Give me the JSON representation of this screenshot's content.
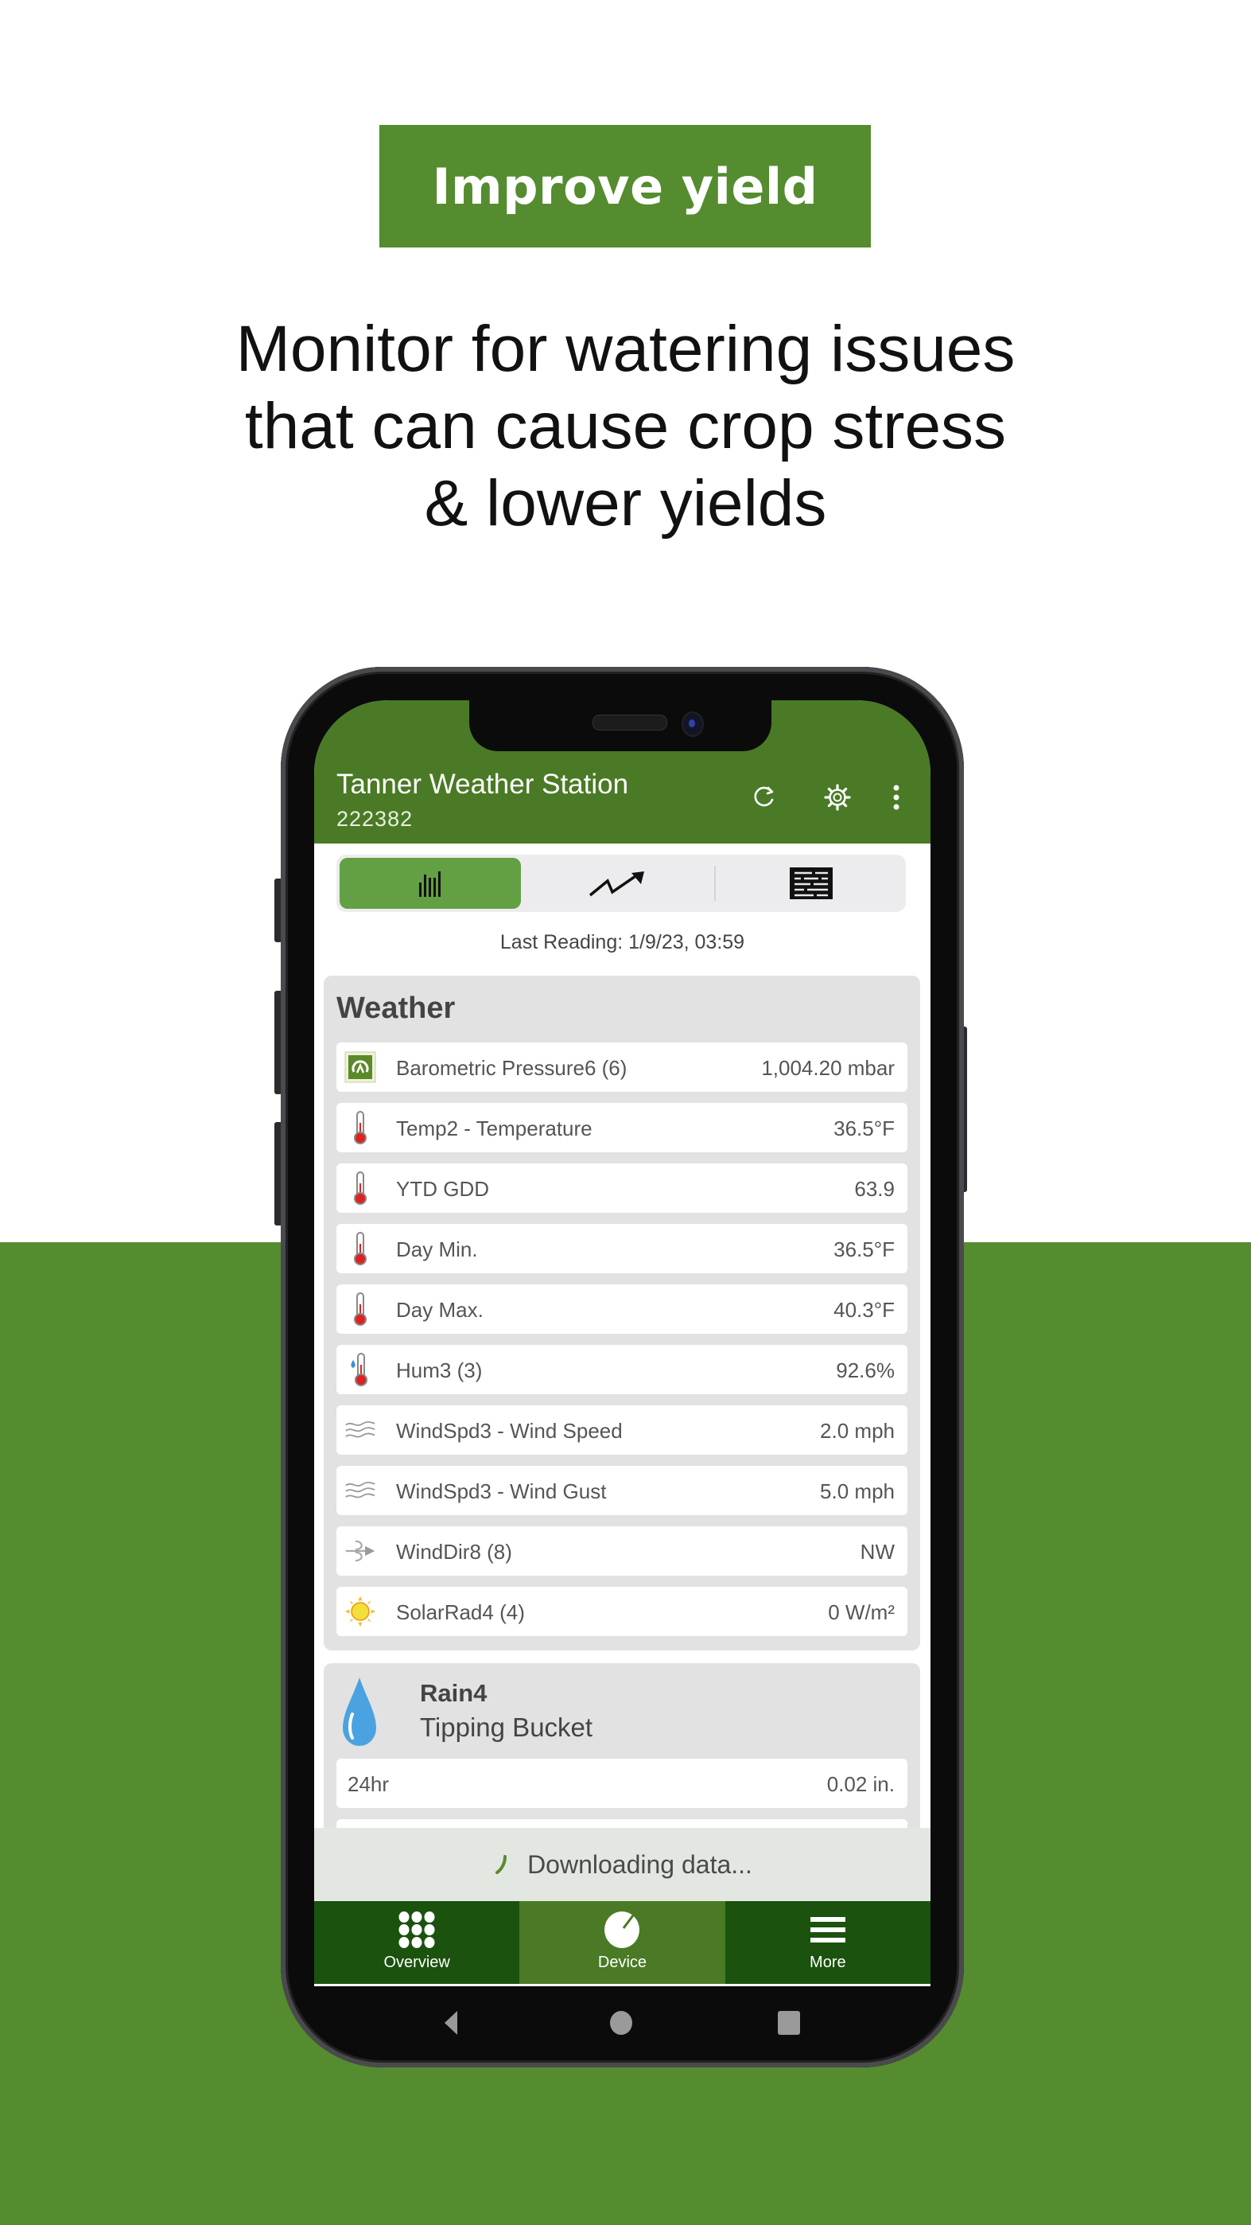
{
  "promo": {
    "badge_label": "Improve yield",
    "subtitle_lines": [
      "Monitor for watering issues",
      "that can cause crop stress",
      "& lower yields"
    ],
    "accent_color": "#548C2F"
  },
  "app": {
    "title": "Tanner Weather Station",
    "device_id": "222382",
    "actions": {
      "refresh_icon": "refresh-icon",
      "settings_icon": "gear-icon",
      "more_icon": "more-vertical-icon"
    },
    "view_tabs": [
      {
        "name": "current-readings",
        "icon": "bar-chart-icon",
        "active": true
      },
      {
        "name": "graph",
        "icon": "trend-arrow-icon",
        "active": false
      },
      {
        "name": "table",
        "icon": "table-list-icon",
        "active": false
      }
    ],
    "last_reading": "Last Reading: 1/9/23, 03:59",
    "weather": {
      "title": "Weather",
      "rows": [
        {
          "icon": "barometer-icon",
          "label": "Barometric Pressure6 (6)",
          "value": "1,004.20 mbar"
        },
        {
          "icon": "thermometer-icon",
          "label": "Temp2 - Temperature",
          "value": "36.5°F"
        },
        {
          "icon": "thermometer-icon",
          "label": "YTD GDD",
          "value": "63.9"
        },
        {
          "icon": "thermometer-icon",
          "label": "Day Min.",
          "value": "36.5°F"
        },
        {
          "icon": "thermometer-icon",
          "label": "Day Max.",
          "value": "40.3°F"
        },
        {
          "icon": "humidity-icon",
          "label": "Hum3 (3)",
          "value": "92.6%"
        },
        {
          "icon": "wind-icon",
          "label": "WindSpd3 - Wind Speed",
          "value": "2.0 mph"
        },
        {
          "icon": "wind-icon",
          "label": "WindSpd3 - Wind Gust",
          "value": "5.0 mph"
        },
        {
          "icon": "wind-direction-icon",
          "label": "WindDir8 (8)",
          "value": "NW"
        },
        {
          "icon": "sun-icon",
          "label": "SolarRad4 (4)",
          "value": "0 W/m²"
        }
      ]
    },
    "rain": {
      "title": "Rain4",
      "subtitle": "Tipping Bucket",
      "rows": [
        {
          "label": "24hr",
          "value": "0.02 in."
        }
      ]
    },
    "status": "Downloading data...",
    "bottom_nav": [
      {
        "label": "Overview",
        "icon": "grid-dots-icon",
        "active": false
      },
      {
        "label": "Device",
        "icon": "gauge-icon",
        "active": true
      },
      {
        "label": "More",
        "icon": "menu-icon",
        "active": false
      }
    ],
    "colors": {
      "appbar": "#4A7A25",
      "segment_active": "#62A043",
      "nav_bg": "#1A520E",
      "nav_active": "#4A7A25"
    }
  }
}
